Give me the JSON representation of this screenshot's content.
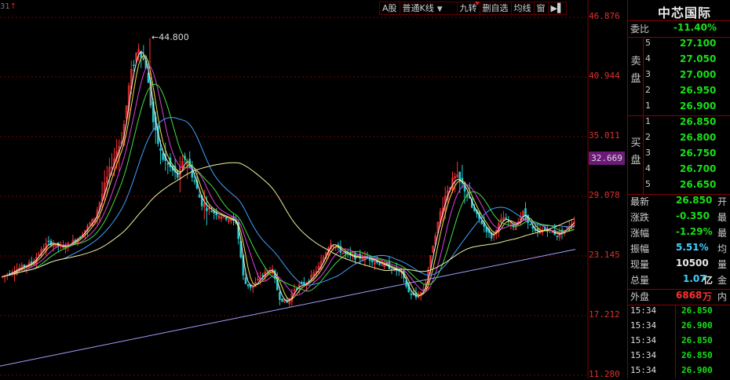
{
  "toolbar": {
    "top_left": "31",
    "buttons": [
      "A股",
      "普通K线",
      "九转",
      "删自选",
      "均线",
      "窗"
    ],
    "exit_icon": "exit-icon"
  },
  "stock": {
    "name": "中芯国际"
  },
  "current_price_tag": "32.669",
  "chart_data": {
    "type": "candlestick",
    "y_axis_ticks": [
      "46.876",
      "40.944",
      "35.011",
      "29.078",
      "23.145",
      "17.212",
      "11.280"
    ],
    "ylim": [
      11.28,
      46.876
    ],
    "peak_label": "44.800",
    "peak_value": 44.8,
    "grid": true,
    "colors": {
      "up": "#ff3232",
      "down": "#24c8c8",
      "ma5": "#f0f0f0",
      "ma10": "#f0e040",
      "ma20": "#e040e0",
      "ma30": "#40e040",
      "ma60": "#40a0ff",
      "ma120": "#f0f0a0",
      "ma250": "#a0a0ff"
    }
  },
  "panel": {
    "weibi": {
      "label": "委比",
      "value": "-11.40%"
    },
    "sell_label": [
      "卖",
      "盘"
    ],
    "buy_label": [
      "买",
      "盘"
    ],
    "sell": [
      {
        "level": "5",
        "price": "27.100"
      },
      {
        "level": "4",
        "price": "27.050"
      },
      {
        "level": "3",
        "price": "27.000"
      },
      {
        "level": "2",
        "price": "26.950"
      },
      {
        "level": "1",
        "price": "26.900"
      }
    ],
    "buy": [
      {
        "level": "1",
        "price": "26.850"
      },
      {
        "level": "2",
        "price": "26.800"
      },
      {
        "level": "3",
        "price": "26.750"
      },
      {
        "level": "4",
        "price": "26.700"
      },
      {
        "level": "5",
        "price": "26.650"
      }
    ],
    "stats": [
      {
        "label": "最新",
        "value": "26.850",
        "right": "开",
        "color": "#18e018"
      },
      {
        "label": "涨跌",
        "value": "-0.350",
        "right": "最",
        "color": "#18e018"
      },
      {
        "label": "涨幅",
        "value": "-1.29%",
        "right": "最",
        "color": "#18e018"
      },
      {
        "label": "振幅",
        "value": "5.51%",
        "right": "均",
        "color": "#40d0ff"
      },
      {
        "label": "现量",
        "value": "10500",
        "right": "量",
        "color": "#e8e8e8"
      },
      {
        "label": "总量",
        "value": "1.07",
        "unit": "亿",
        "right": "金",
        "color": "#40d0ff"
      }
    ],
    "outer": {
      "label": "外盘",
      "value": "6868",
      "unit": "万",
      "right": "内"
    },
    "ticks": [
      {
        "time": "15:34",
        "price": "26.850"
      },
      {
        "time": "15:34",
        "price": "26.900"
      },
      {
        "time": "15:34",
        "price": "26.850"
      },
      {
        "time": "15:34",
        "price": "26.850"
      },
      {
        "time": "15:34",
        "price": "26.900"
      }
    ]
  }
}
